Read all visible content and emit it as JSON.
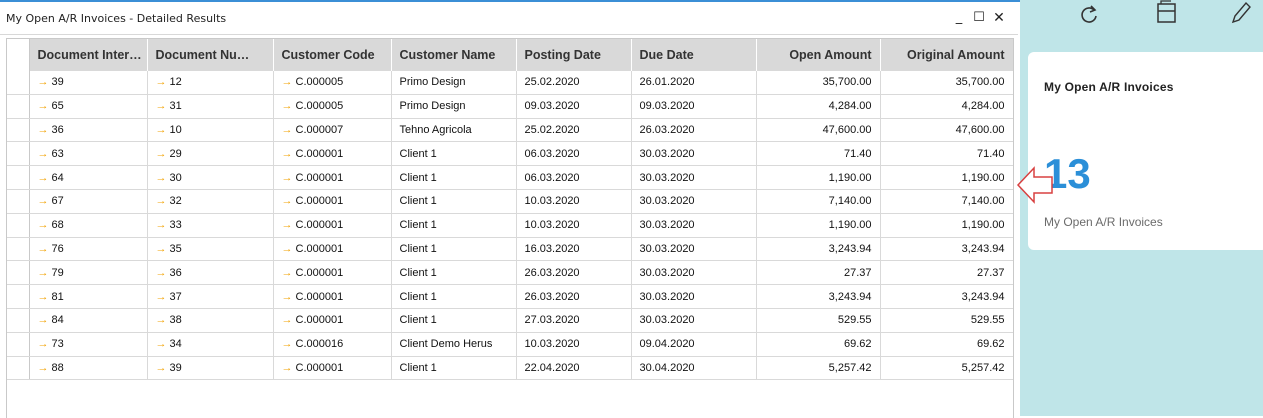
{
  "window": {
    "title": "My Open A/R Invoices - Detailed Results",
    "minimize_glyph": "_",
    "maximize_glyph": "☐",
    "close_glyph": "✕"
  },
  "table": {
    "headers": [
      "Document Inter…",
      "Document Nu…",
      "Customer Code",
      "Customer Name",
      "Posting Date",
      "Due Date",
      "Open Amount",
      "Original Amount"
    ],
    "link_icon": "orange-right-arrow-icon",
    "rows": [
      {
        "doc_internal": "39",
        "doc_num": "12",
        "cust_code": "C.000005",
        "cust_name": "Primo Design",
        "posting": "25.02.2020",
        "due": "26.01.2020",
        "open": "35,700.00",
        "original": "35,700.00"
      },
      {
        "doc_internal": "65",
        "doc_num": "31",
        "cust_code": "C.000005",
        "cust_name": "Primo Design",
        "posting": "09.03.2020",
        "due": "09.03.2020",
        "open": "4,284.00",
        "original": "4,284.00"
      },
      {
        "doc_internal": "36",
        "doc_num": "10",
        "cust_code": "C.000007",
        "cust_name": "Tehno Agricola",
        "posting": "25.02.2020",
        "due": "26.03.2020",
        "open": "47,600.00",
        "original": "47,600.00"
      },
      {
        "doc_internal": "63",
        "doc_num": "29",
        "cust_code": "C.000001",
        "cust_name": "Client 1",
        "posting": "06.03.2020",
        "due": "30.03.2020",
        "open": "71.40",
        "original": "71.40"
      },
      {
        "doc_internal": "64",
        "doc_num": "30",
        "cust_code": "C.000001",
        "cust_name": "Client 1",
        "posting": "06.03.2020",
        "due": "30.03.2020",
        "open": "1,190.00",
        "original": "1,190.00"
      },
      {
        "doc_internal": "67",
        "doc_num": "32",
        "cust_code": "C.000001",
        "cust_name": "Client 1",
        "posting": "10.03.2020",
        "due": "30.03.2020",
        "open": "7,140.00",
        "original": "7,140.00"
      },
      {
        "doc_internal": "68",
        "doc_num": "33",
        "cust_code": "C.000001",
        "cust_name": "Client 1",
        "posting": "10.03.2020",
        "due": "30.03.2020",
        "open": "1,190.00",
        "original": "1,190.00"
      },
      {
        "doc_internal": "76",
        "doc_num": "35",
        "cust_code": "C.000001",
        "cust_name": "Client 1",
        "posting": "16.03.2020",
        "due": "30.03.2020",
        "open": "3,243.94",
        "original": "3,243.94"
      },
      {
        "doc_internal": "79",
        "doc_num": "36",
        "cust_code": "C.000001",
        "cust_name": "Client 1",
        "posting": "26.03.2020",
        "due": "30.03.2020",
        "open": "27.37",
        "original": "27.37"
      },
      {
        "doc_internal": "81",
        "doc_num": "37",
        "cust_code": "C.000001",
        "cust_name": "Client 1",
        "posting": "26.03.2020",
        "due": "30.03.2020",
        "open": "3,243.94",
        "original": "3,243.94"
      },
      {
        "doc_internal": "84",
        "doc_num": "38",
        "cust_code": "C.000001",
        "cust_name": "Client 1",
        "posting": "27.03.2020",
        "due": "30.03.2020",
        "open": "529.55",
        "original": "529.55"
      },
      {
        "doc_internal": "73",
        "doc_num": "34",
        "cust_code": "C.000016",
        "cust_name": "Client Demo Herus",
        "posting": "10.03.2020",
        "due": "09.04.2020",
        "open": "69.62",
        "original": "69.62"
      },
      {
        "doc_internal": "88",
        "doc_num": "39",
        "cust_code": "C.000001",
        "cust_name": "Client 1",
        "posting": "22.04.2020",
        "due": "30.04.2020",
        "open": "5,257.42",
        "original": "5,257.42"
      }
    ]
  },
  "side": {
    "toolbar_icons": [
      "refresh-icon",
      "folder-icon",
      "edit-pencil-icon"
    ],
    "tile": {
      "title": "My Open A/R Invoices",
      "count": "13",
      "subtitle": "My Open A/R Invoices"
    }
  },
  "colors": {
    "accent_blue": "#2b8fd8",
    "panel_teal": "#bfe5e8",
    "link_arrow": "#f2a200",
    "pointer_red": "#d84040"
  }
}
